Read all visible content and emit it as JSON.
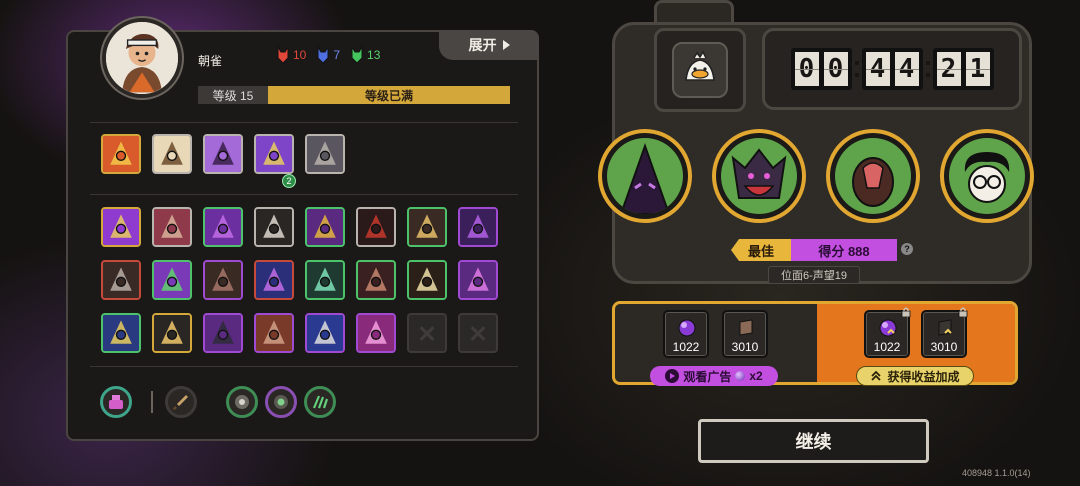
{
  "character": {
    "name": "朝雀",
    "expand_label": "展开",
    "level_label": "等级 15",
    "level_status": "等级已满",
    "tokens": [
      {
        "name": "red-mask-token",
        "value": "10",
        "color": "#e0483a"
      },
      {
        "name": "blue-mask-token",
        "value": "7",
        "color": "#4f6fe0"
      },
      {
        "name": "green-mask-token",
        "value": "13",
        "color": "#45c45e"
      }
    ],
    "badge_count": "2"
  },
  "result": {
    "timer": {
      "h": "00",
      "m": "44",
      "s": "21"
    },
    "best_label": "最佳",
    "score_label": "得分 888",
    "help_glyph": "?",
    "plane_label": "位面6-声望19"
  },
  "rewards": {
    "base": [
      {
        "name": "purple-gem",
        "amount": "1022"
      },
      {
        "name": "book",
        "amount": "3010"
      }
    ],
    "bonus": [
      {
        "name": "purple-gem",
        "amount": "1022"
      },
      {
        "name": "book",
        "amount": "3010"
      }
    ],
    "watch_ad_label": "观看广告",
    "watch_ad_mult": "x2",
    "bonus_label": "获得收益加成"
  },
  "continue_label": "继续",
  "version": "408948 1.1.0(14)",
  "colors": {
    "accent_gold": "#e1a731",
    "accent_purple": "#c24fe0",
    "bonus_orange": "#e4761e",
    "level_fill": "#d3a73a"
  }
}
